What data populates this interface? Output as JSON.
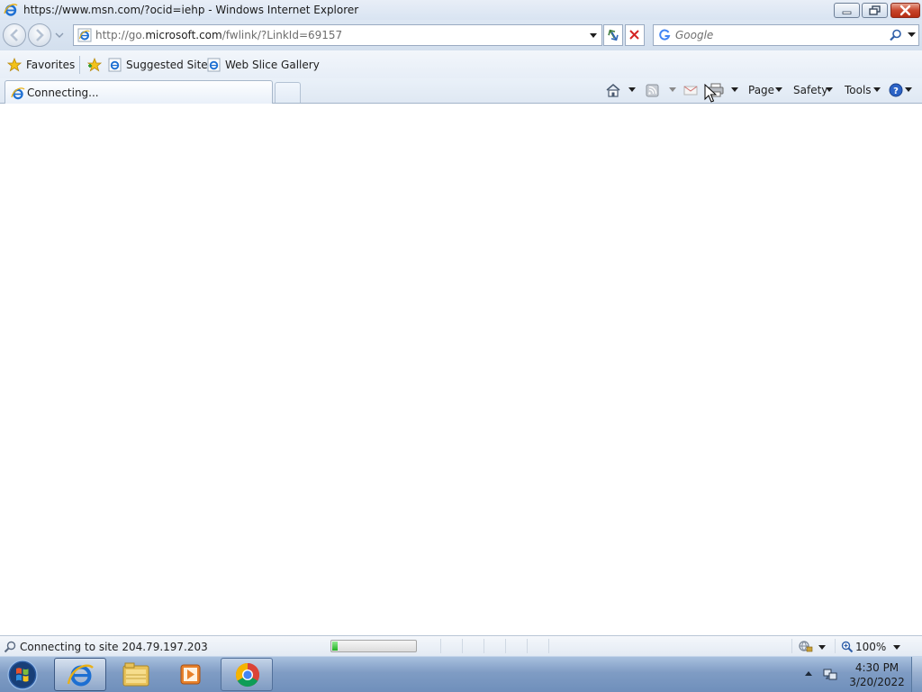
{
  "window": {
    "title": "https://www.msn.com/?ocid=iehp - Windows Internet Explorer"
  },
  "address_bar": {
    "url_prefix": "http://go.",
    "url_domain": "microsoft.com",
    "url_suffix": "/fwlink/?LinkId=69157"
  },
  "search": {
    "placeholder": "Google"
  },
  "favorites_bar": {
    "favorites_label": "Favorites",
    "links": [
      {
        "label": "Suggested Sites"
      },
      {
        "label": "Web Slice Gallery"
      }
    ]
  },
  "tab": {
    "label": "Connecting..."
  },
  "command_bar": {
    "page_label": "Page",
    "safety_label": "Safety",
    "tools_label": "Tools"
  },
  "status_bar": {
    "text": "Connecting to site 204.79.197.203",
    "progress_fraction": 0.06,
    "zoom": "100%"
  },
  "taskbar": {
    "time": "4:30 PM",
    "date": "3/20/2022"
  },
  "colors": {
    "chrome_bg": "#dde7f3",
    "close_button": "#c8452c",
    "progress_fill": "#22b222",
    "taskbar": "#7f9cc4"
  }
}
